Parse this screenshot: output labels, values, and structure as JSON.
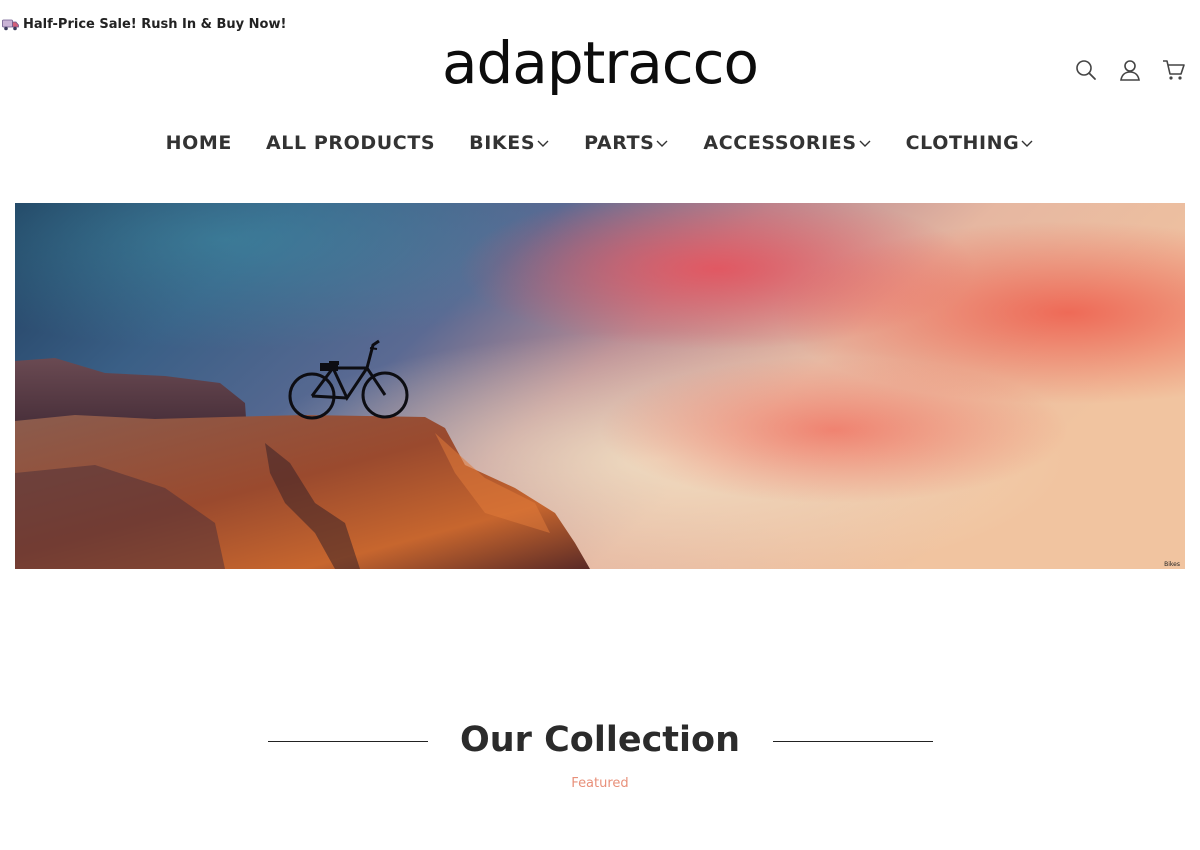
{
  "promo": {
    "text": "Half-Price Sale! Rush In & Buy Now!"
  },
  "logo": {
    "text": "adaptracco"
  },
  "header_icons": [
    "search-icon",
    "user-icon",
    "cart-icon"
  ],
  "nav": {
    "items": [
      {
        "label": "HOME",
        "dropdown": false
      },
      {
        "label": "ALL PRODUCTS",
        "dropdown": false
      },
      {
        "label": "BIKES",
        "dropdown": true
      },
      {
        "label": "PARTS",
        "dropdown": true
      },
      {
        "label": "ACCESSORIES",
        "dropdown": true
      },
      {
        "label": "CLOTHING",
        "dropdown": true
      }
    ]
  },
  "hero": {
    "caption": "Bikes"
  },
  "collection": {
    "title": "Our Collection",
    "subtitle": "Featured"
  },
  "colors": {
    "accent": "#e8907a",
    "text": "#2b2b2b"
  }
}
